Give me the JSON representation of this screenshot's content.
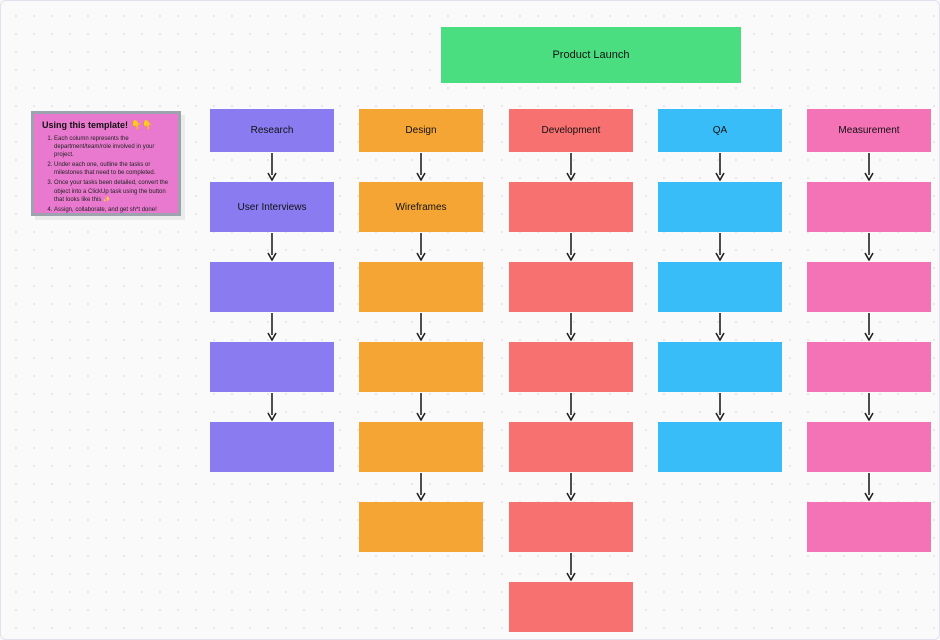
{
  "header": {
    "title": "Product Launch"
  },
  "sticky": {
    "title": "Using this template! 👇👇",
    "items": [
      "Each column represents the department/team/role involved in your project.",
      "Under each one, outline the tasks or milestones that need to be completed.",
      "Once your tasks been detailed, convert the object into a ClickUp task using the button that looks like this ✨",
      "Assign, collaborate, and get sh*t done!"
    ]
  },
  "columns": [
    {
      "id": "research",
      "color": "purple",
      "cells": [
        "Research",
        "User Interviews",
        "",
        "",
        ""
      ],
      "arrows_after": [
        true,
        true,
        true,
        true,
        false
      ]
    },
    {
      "id": "design",
      "color": "orange",
      "cells": [
        "Design",
        "Wireframes",
        "",
        "",
        "",
        ""
      ],
      "arrows_after": [
        true,
        true,
        true,
        true,
        true,
        false
      ]
    },
    {
      "id": "development",
      "color": "coral",
      "cells": [
        "Development",
        "",
        "",
        "",
        "",
        "",
        ""
      ],
      "arrows_after": [
        true,
        true,
        true,
        true,
        true,
        true,
        false
      ]
    },
    {
      "id": "qa",
      "color": "blue",
      "cells": [
        "QA",
        "",
        "",
        "",
        ""
      ],
      "arrows_after": [
        true,
        true,
        true,
        true,
        false
      ]
    },
    {
      "id": "measurement",
      "color": "pink",
      "cells": [
        "Measurement",
        "",
        "",
        "",
        "",
        ""
      ],
      "arrows_after": [
        true,
        true,
        true,
        true,
        true,
        false
      ]
    }
  ],
  "colors": {
    "header": "#4ade80",
    "purple": "#8b7bf0",
    "orange": "#f5a533",
    "coral": "#f87171",
    "blue": "#38bdf8",
    "pink": "#f472b6",
    "sticky": "#e879cf"
  }
}
